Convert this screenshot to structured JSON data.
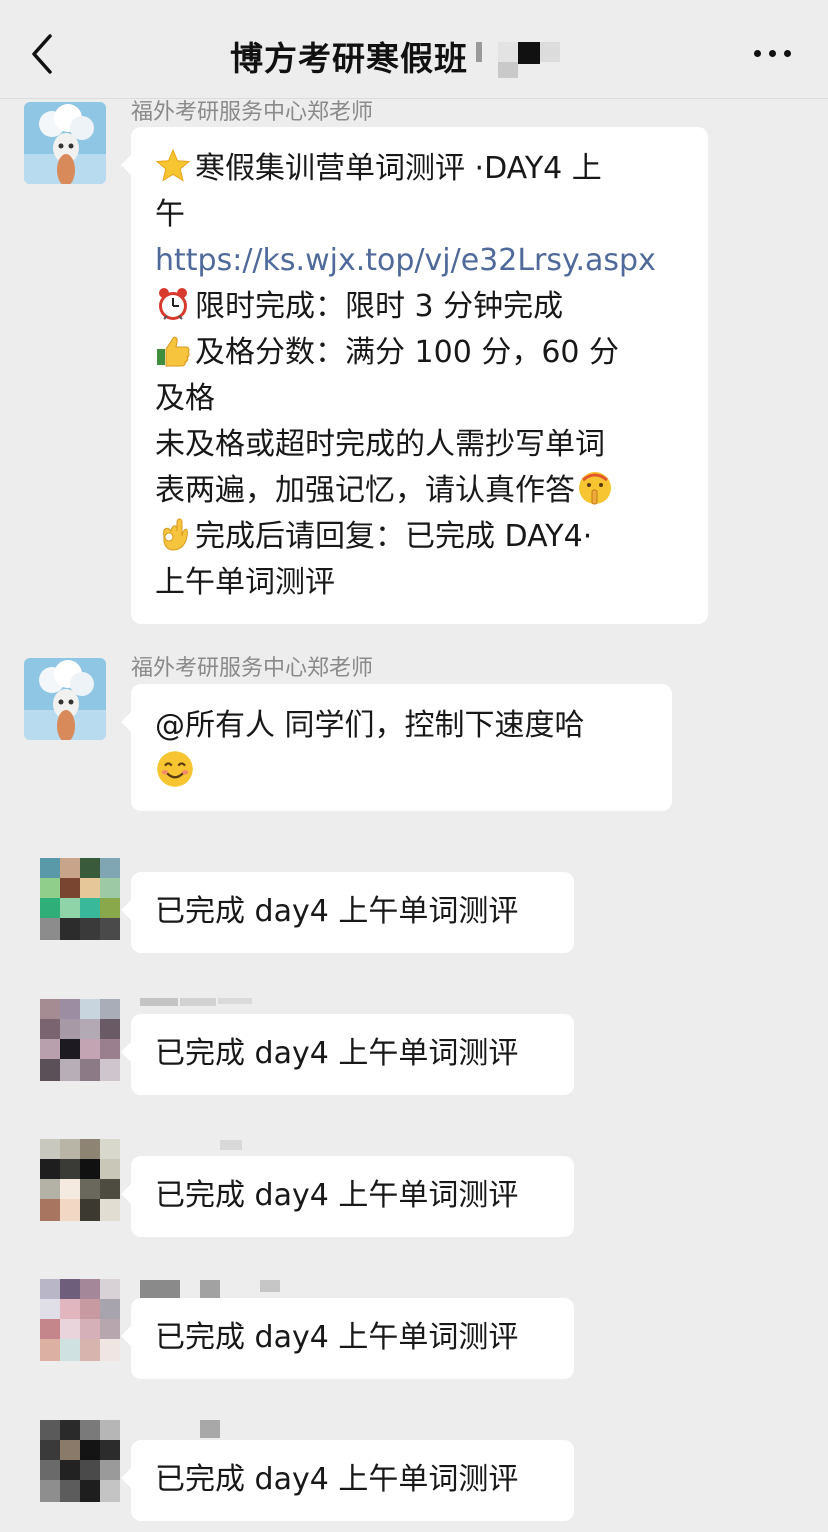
{
  "header": {
    "title": "博方考研寒假班",
    "back_icon": "chevron-left-icon",
    "more_icon": "more-dots-icon"
  },
  "messages": [
    {
      "sender": "福外考研服务中心郑老师",
      "lines": [
        "寒假集训营单词测评 ·DAY4 上",
        "午",
        "https://ks.wjx.top/vj/e32Lrsy.aspx",
        "限时完成：限时 3 分钟完成",
        "及格分数：满分 100 分，60 分",
        "及格",
        "未及格或超时完成的人需抄写单词",
        "表两遍，加强记忆，请认真作答",
        "完成后请回复：已完成 DAY4·",
        "上午单词测评"
      ],
      "icons": [
        "star-icon",
        "alarm-clock-icon",
        "thumbs-up-icon",
        "shushing-face-icon",
        "ok-hand-icon"
      ]
    },
    {
      "sender": "福外考研服务中心郑老师",
      "lines": [
        "@所有人 同学们，控制下速度哈"
      ],
      "icons": [
        "smiling-face-icon"
      ]
    },
    {
      "text": "已完成 day4 上午单词测评"
    },
    {
      "text": "已完成 day4 上午单词测评"
    },
    {
      "text": "已完成 day4 上午单词测评"
    },
    {
      "text": "已完成 day4 上午单词测评"
    },
    {
      "text": "已完成 day4 上午单词测评"
    }
  ],
  "colors": {
    "background": "#ededed",
    "bubble": "#ffffff",
    "link": "#4f6a9a",
    "sender": "#8a8a8a"
  }
}
